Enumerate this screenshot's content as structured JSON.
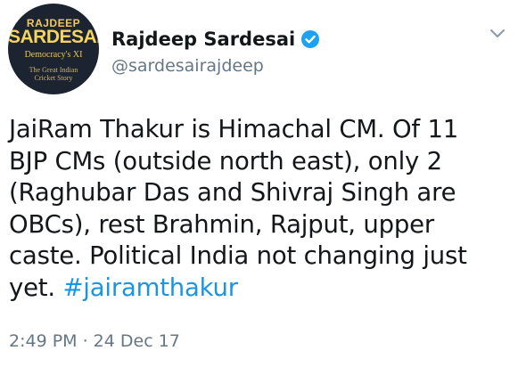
{
  "author": {
    "display_name": "Rajdeep Sardesai",
    "handle": "@sardesairajdeep",
    "verified": true,
    "verified_icon": "verified-badge-icon",
    "avatar": {
      "line1": "RAJDEEP",
      "line2": "SARDESAI",
      "line3": "Democracy's XI",
      "line4": "The Great Indian",
      "line5": "Cricket Story"
    }
  },
  "menu_icon": "chevron-down-icon",
  "tweet": {
    "lines": [
      "JaiRam Thakur is Himachal CM. Of 11",
      "BJP CMs (outside north east), only 2",
      "(Raghubar Das and Shivraj Singh are",
      "OBCs), rest Brahmin, Rajput, upper",
      "caste. Political India not changing just"
    ],
    "last_line_prefix": "yet. ",
    "hashtag": "#jairamthakur"
  },
  "timestamp": "2:49 PM · 24 Dec 17",
  "colors": {
    "accent": "#1b95e0",
    "secondary_text": "#657786",
    "primary_text": "#14171a",
    "verified_badge": "#1da1f2"
  }
}
